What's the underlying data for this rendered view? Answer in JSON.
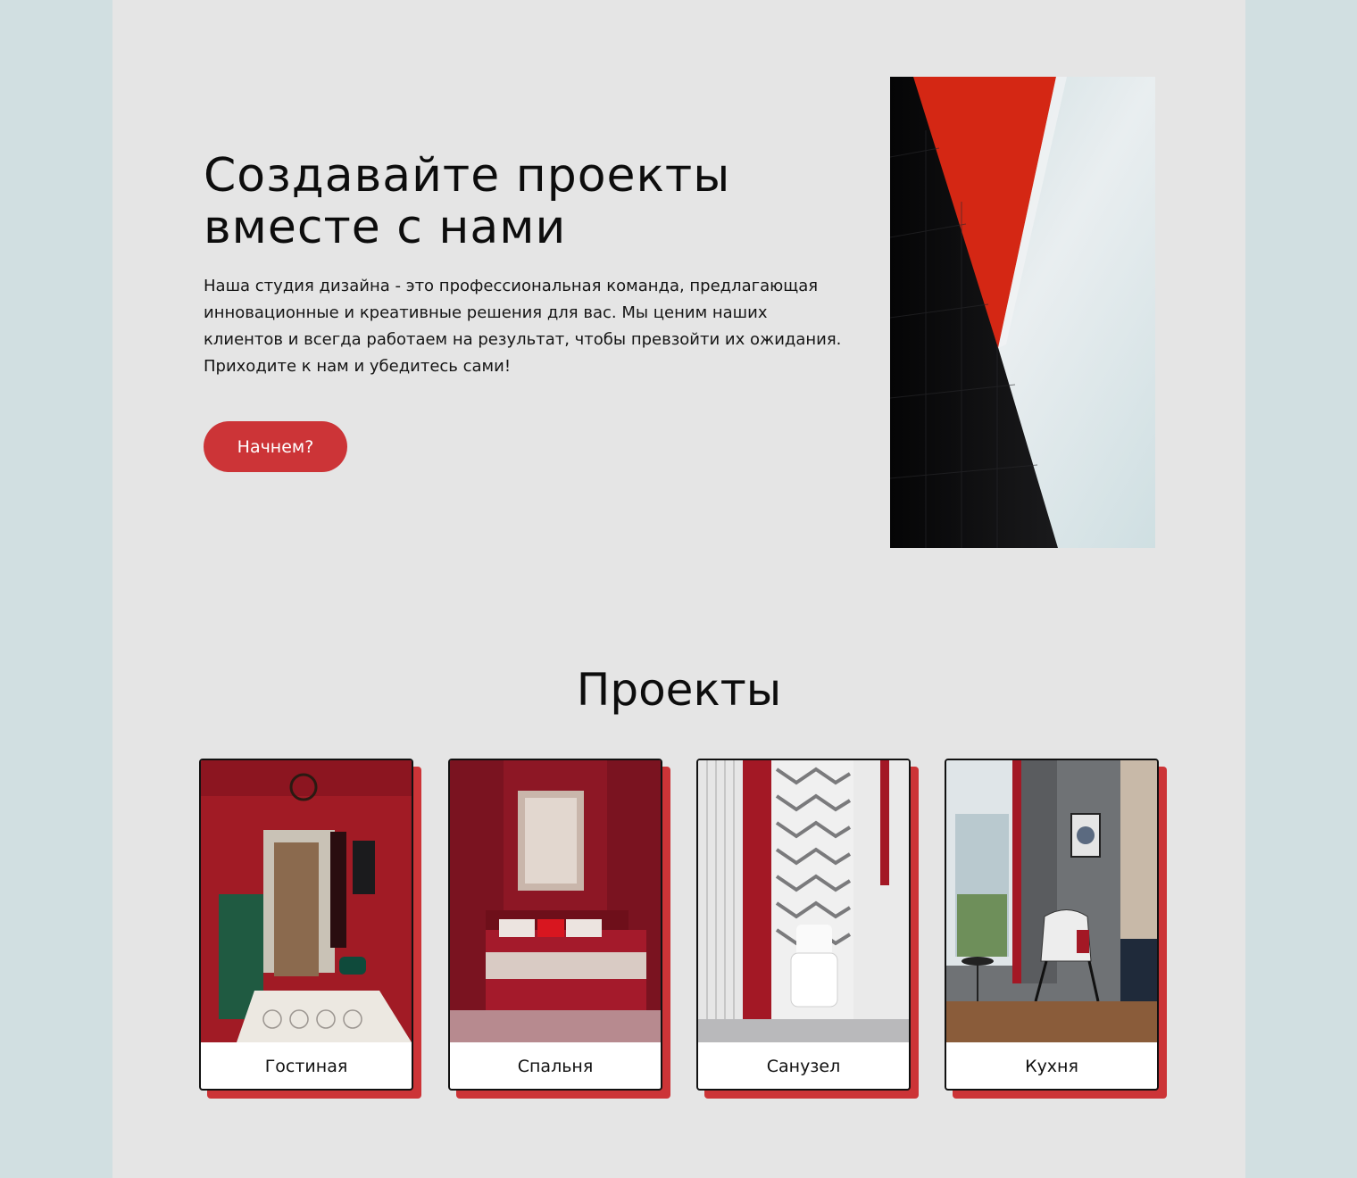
{
  "hero": {
    "title_line1": "Создавайте проекты",
    "title_line2": "вместе с нами",
    "description": "Наша студия дизайна - это профессиональная команда, предлагающая инновационные и креативные решения для вас. Мы ценим наших клиентов и всегда работаем на результат, чтобы превзойти их ожидания. Приходите к нам и убедитесь сами!",
    "cta_label": "Начнем?",
    "image": "abstract-red-black-geometric-image"
  },
  "projects": {
    "title": "Проекты",
    "cards": [
      {
        "label": "Гостиная",
        "image": "red-hallway-interior-photo"
      },
      {
        "label": "Спальня",
        "image": "red-bedroom-interior-photo"
      },
      {
        "label": "Санузел",
        "image": "red-bathroom-interior-photo"
      },
      {
        "label": "Кухня",
        "image": "armchair-room-interior-photo"
      }
    ]
  },
  "colors": {
    "accent": "#cc3437",
    "page_background": "#e5e5e5",
    "outer_background": "#d1dfe1",
    "text": "#111111"
  }
}
